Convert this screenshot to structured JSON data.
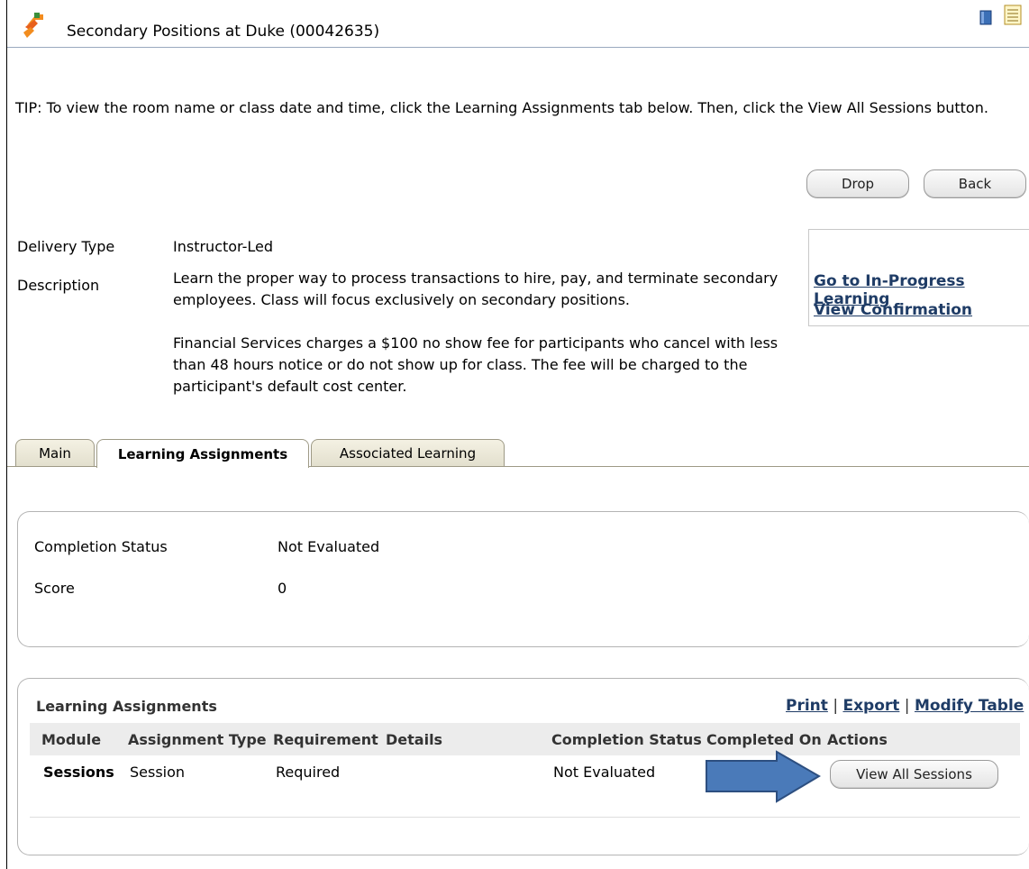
{
  "header": {
    "title": "Secondary Positions at Duke (00042635)",
    "app_icon": "learning-app-icon",
    "toolbar_icons": [
      "book-icon",
      "notes-icon"
    ]
  },
  "tip": "TIP: To view the room name or class date and time, click the Learning Assignments tab below. Then, click the View All Sessions button.",
  "actions": {
    "drop": "Drop",
    "back": "Back"
  },
  "details": {
    "delivery_type_label": "Delivery Type",
    "delivery_type_value": "Instructor-Led",
    "description_label": "Description",
    "description_p1": "Learn the proper way to process transactions to hire, pay, and terminate secondary employees. Class will focus exclusively on secondary positions.",
    "description_p2": "Financial Services charges a $100 no show fee for participants who cancel with less than 48 hours notice or do not show up for class. The fee will be charged to the participant's default cost center."
  },
  "side_links": {
    "in_progress": "Go to In-Progress Learning",
    "confirmation": "View Confirmation"
  },
  "tabs": [
    {
      "label": "Main"
    },
    {
      "label": "Learning Assignments",
      "active": true
    },
    {
      "label": "Associated Learning"
    }
  ],
  "status_panel": {
    "completion_status_label": "Completion Status",
    "completion_status_value": "Not Evaluated",
    "score_label": "Score",
    "score_value": "0"
  },
  "assignments": {
    "title": "Learning Assignments",
    "links": {
      "print": "Print",
      "separator": "|",
      "export": "Export",
      "modify": "Modify Table"
    },
    "columns": [
      "Module",
      "Assignment Type",
      "Requirement",
      "Details",
      "Completion Status",
      "Completed On",
      "Actions"
    ],
    "rows": [
      {
        "module": "Sessions",
        "assignment_type": "Session",
        "requirement": "Required",
        "details": "",
        "completion_status": "Not Evaluated",
        "completed_on": "",
        "action": "View All Sessions"
      }
    ]
  },
  "annotation": {
    "arrow": "blue-arrow-icon",
    "color": "#4a7ab9"
  }
}
